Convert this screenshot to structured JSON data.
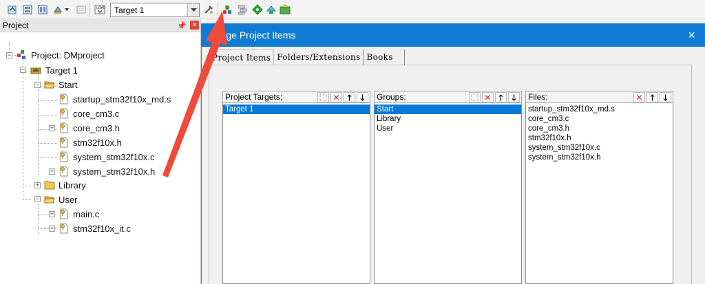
{
  "toolbar": {
    "target_value": "Target 1",
    "icons": [
      "translate-icon",
      "build-icon",
      "rebuild-icon",
      "batch-build-icon",
      "stop-build-icon",
      "download-icon",
      "target-options-icon",
      "manage-project-items-icon",
      "manage-components-icon",
      "select-packs-icon",
      "pack-installer-icon",
      "manage-rte-icon"
    ]
  },
  "project_panel": {
    "title": "Project",
    "tree": {
      "project_label": "Project: DMproject",
      "target_label": "Target 1",
      "groups": [
        {
          "label": "Start",
          "files": [
            "startup_stm32f10x_md.s",
            "core_cm3.c",
            "core_cm3.h",
            "stm32f10x.h",
            "system_stm32f10x.c",
            "system_stm32f10x.h"
          ]
        },
        {
          "label": "Library",
          "files": []
        },
        {
          "label": "User",
          "files": [
            "main.c",
            "stm32f10x_it.c"
          ]
        }
      ]
    }
  },
  "dialog": {
    "title": "anage Project Items",
    "close_glyph": "×",
    "tabs": [
      "Project Items",
      "Folders/Extensions",
      "Books"
    ],
    "project_targets": {
      "label": "Project Targets:",
      "items": [
        "Target 1"
      ],
      "selected": 0
    },
    "groups": {
      "label": "Groups:",
      "items": [
        "Start",
        "Library",
        "User"
      ],
      "selected": 0
    },
    "files": {
      "label": "Files:",
      "items": [
        "startup_stm32f10x_md.s",
        "core_cm3.c",
        "core_cm3.h",
        "stm32f10x.h",
        "system_stm32f10x.c",
        "system_stm32f10x.h"
      ]
    }
  },
  "colors": {
    "title_bar": "#0f7bd2",
    "selection": "#0a78d7",
    "annotation_arrow": "#f04a3a"
  }
}
